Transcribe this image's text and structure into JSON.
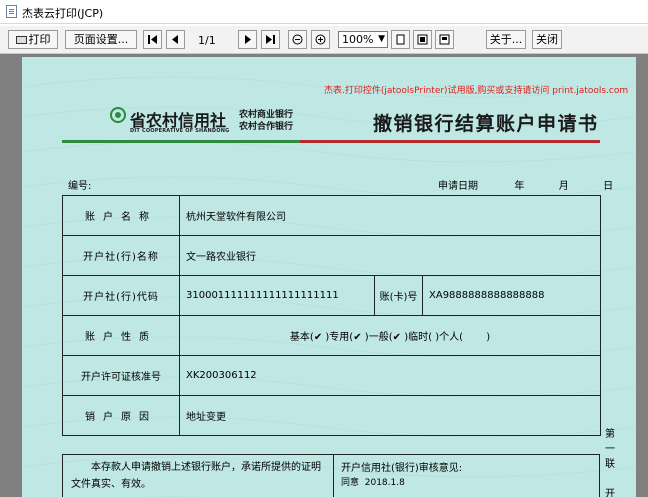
{
  "window": {
    "title": "杰表云打印(JCP)"
  },
  "toolbar": {
    "print_label": "打印",
    "page_setup_label": "页面设置...",
    "pager": "1/1",
    "zoom": "100%",
    "about_label": "关于...",
    "close_label": "关闭"
  },
  "document": {
    "promo": "杰表.打印控件(jatoolsPrinter)试用版,购买或支持请访问 print.jatools.com",
    "bank_name": "省农村信用社",
    "bank_name_en": "DIT COOPERATIVE OF SHANDONG",
    "bank_sub1": "农村商业银行",
    "bank_sub2": "农村合作银行",
    "title": "撤销银行结算账户申请书",
    "number_label": "编号:",
    "date_label": "申请日期",
    "date_year": "年",
    "date_month": "月",
    "date_day": "日",
    "rows": {
      "account_name_label": "账户名称",
      "account_name_value": "杭州天堂软件有限公司",
      "bank_name_label": "开户社(行)名称",
      "bank_name_value": "文一路农业银行",
      "bank_code_label": "开户社(行)代码",
      "bank_code_value": "310001111111111111111111",
      "card_no_label": "账(卡)号",
      "card_no_value": "XA9888888888888888",
      "account_type_label": "账户性质",
      "type_basic": "基本(",
      "type_basic_check": "✔",
      "type_special": ")专用(",
      "type_special_check": "✔",
      "type_general": ")一般(",
      "type_general_check": "✔",
      "type_temp": ")临时(",
      "type_temp_tail": ")个人(",
      "type_end": ")",
      "license_label": "开户许可证核准号",
      "license_value": "XK200306112",
      "reason_label": "销户原因",
      "reason_value": "地址变更"
    },
    "declaration": "本存款人申请撤销上述银行账户，承诺所提供的证明文件真实、有效。",
    "review_label": "开户信用社(银行)审核意见:",
    "review_value": "同意",
    "review_date": "2018.1.8",
    "side_text": [
      "第",
      "一",
      "联",
      "",
      "开"
    ]
  },
  "colors": {
    "paper": "#bfe7e4",
    "viewer_bg": "#808080",
    "promo": "#e0201a",
    "rule_green": "#2d8a3e",
    "rule_red": "#b32a2a"
  }
}
